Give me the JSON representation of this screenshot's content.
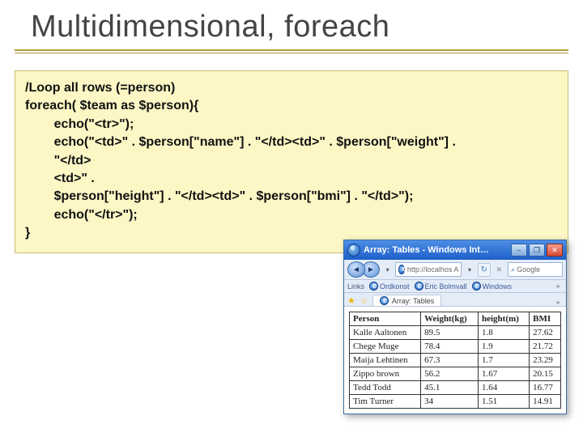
{
  "title": "Multidimensional, foreach",
  "code": {
    "line1": "/Loop all rows (=person)",
    "line2": "foreach( $team as $person){",
    "line3": "        echo(\"<tr>\");",
    "line4": "        echo(\"<td>\" . $person[\"name\"] . \"</td><td>\" . $person[\"weight\"] .",
    "line5": "        \"</td>",
    "line6": "        <td>\" .",
    "line7": "        $person[\"height\"] . \"</td><td>\" . $person[\"bmi\"] . \"</td>\");",
    "line8": "        echo(\"</tr>\");",
    "line9": "}"
  },
  "browser": {
    "window_title": "Array: Tables - Windows Int…",
    "address": "http://localhos A",
    "search_placeholder": "Google",
    "links_label": "Links",
    "link_items": [
      "Ordkonst",
      "Eric Bolmvall",
      "Windows"
    ],
    "tab_label": "Array: Tables"
  },
  "chart_data": {
    "type": "table",
    "headers": [
      "Person",
      "Weight(kg)",
      "height(m)",
      "BMI"
    ],
    "rows": [
      [
        "Kalle Aaltonen",
        "89.5",
        "1.8",
        "27.62"
      ],
      [
        "Chege Muge",
        "78.4",
        "1.9",
        "21.72"
      ],
      [
        "Maija Lehtinen",
        "67.3",
        "1.7",
        "23.29"
      ],
      [
        "Zippo brown",
        "56.2",
        "1.67",
        "20.15"
      ],
      [
        "Tedd Todd",
        "45.1",
        "1.64",
        "16.77"
      ],
      [
        "Tim Turner",
        "34",
        "1.51",
        "14.91"
      ]
    ]
  }
}
